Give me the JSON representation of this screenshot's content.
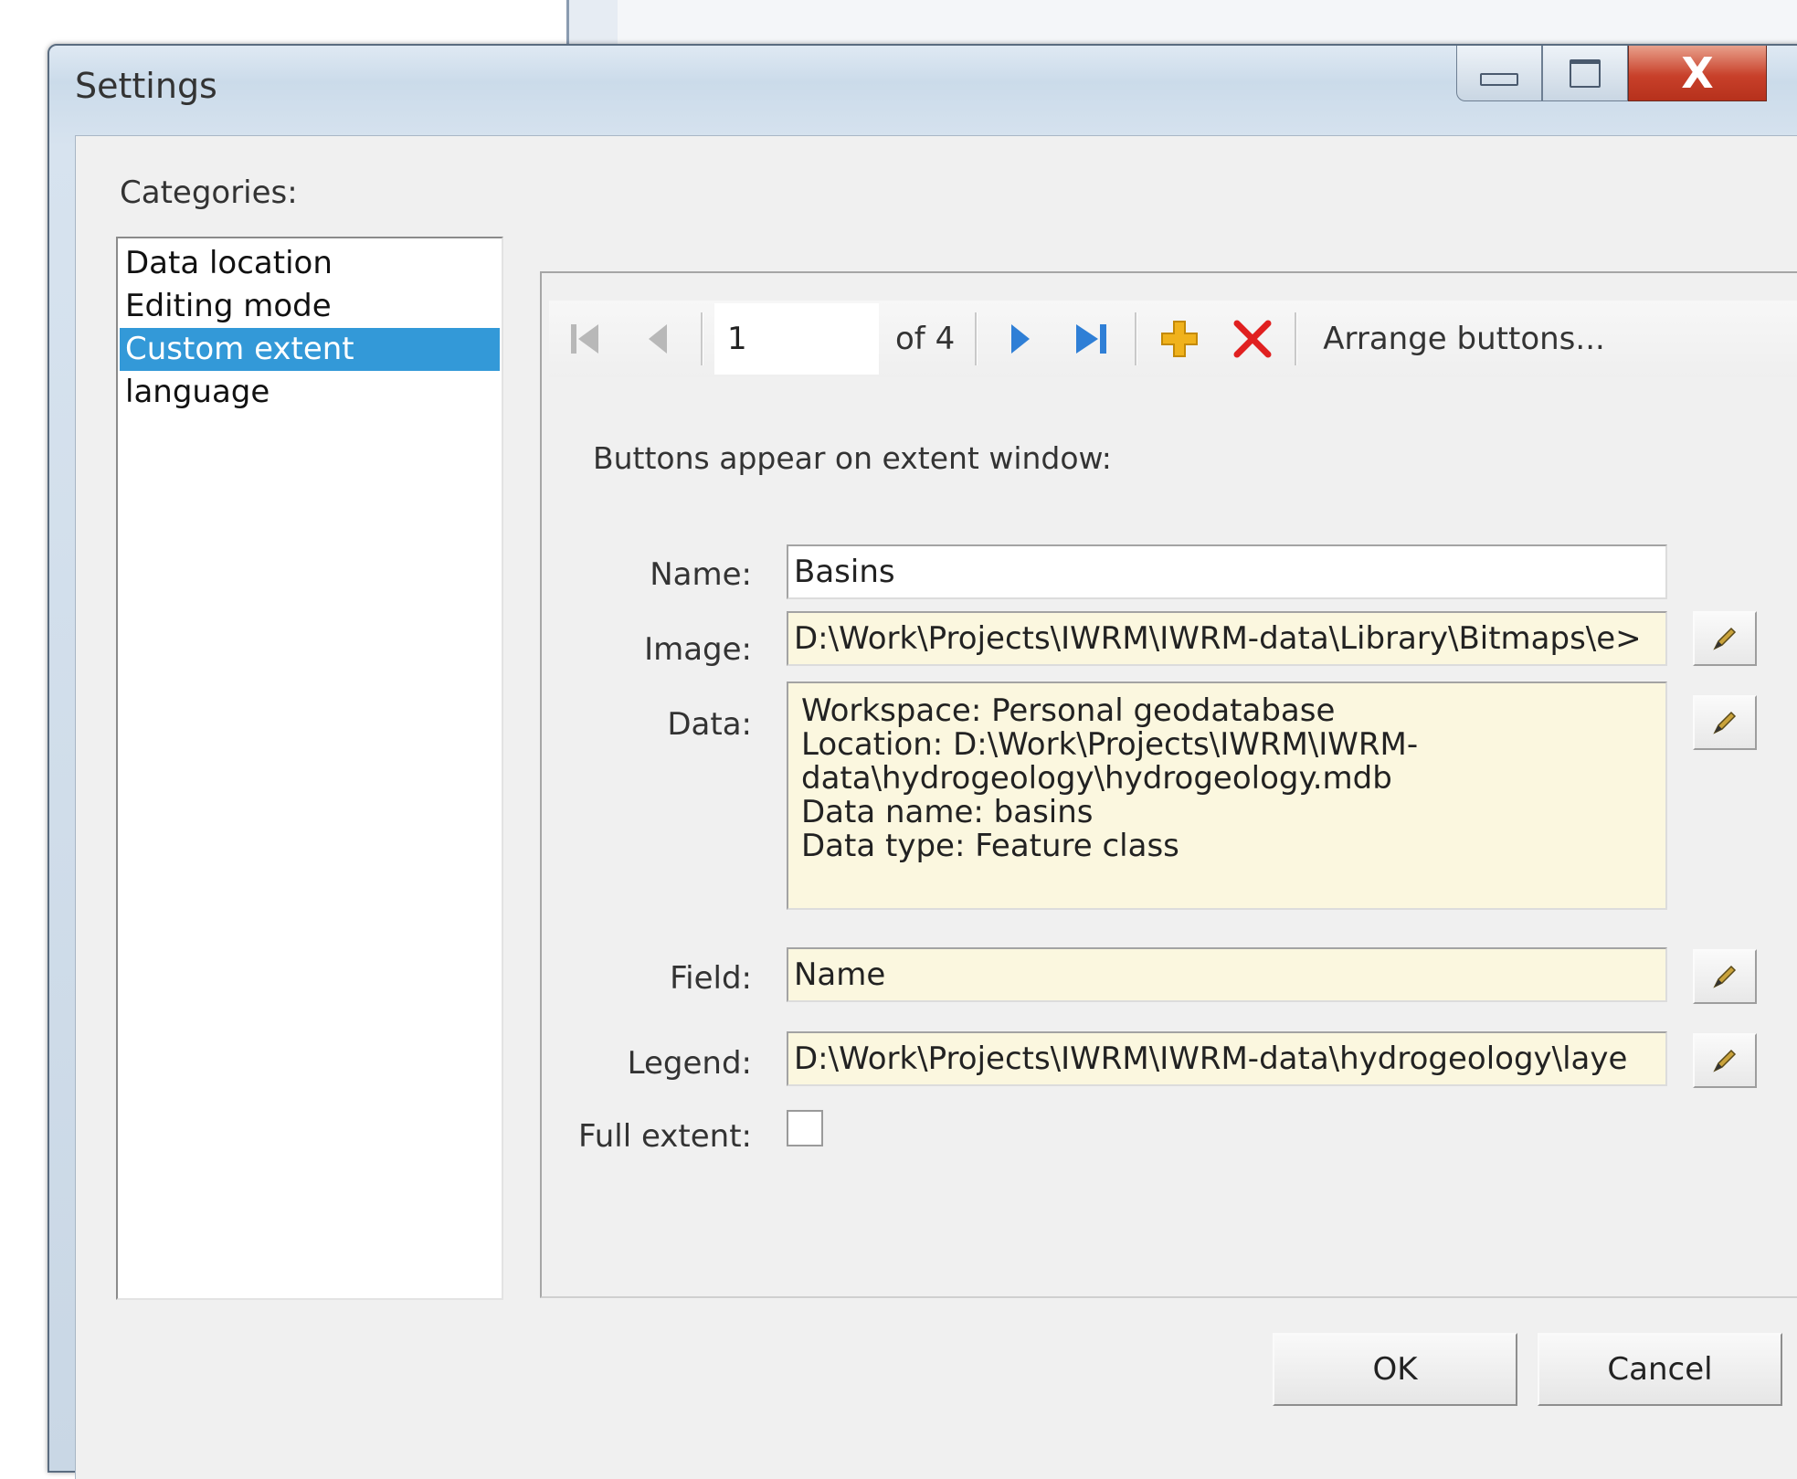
{
  "window": {
    "title": "Settings",
    "close_glyph": "X",
    "icons": {
      "minimize": "minimize-icon",
      "maximize": "maximize-icon",
      "close": "close-icon"
    }
  },
  "categories": {
    "label": "Categories:",
    "items": [
      {
        "label": "Data location",
        "selected": false
      },
      {
        "label": "Editing mode",
        "selected": false
      },
      {
        "label": "Custom extent",
        "selected": true
      },
      {
        "label": "language",
        "selected": false
      }
    ]
  },
  "navigator": {
    "position": "1",
    "count_label": "of 4",
    "arrange_label": "Arrange buttons...",
    "colors": {
      "nav_disabled": "#b8b8b8",
      "nav_active": "#2f7fd6",
      "add": "#f0b21c",
      "delete": "#e02020"
    }
  },
  "form": {
    "hint": "Buttons appear on extent window:",
    "name_label": "Name:",
    "name_value": "Basins",
    "image_label": "Image:",
    "image_value": "D:\\Work\\Projects\\IWRM\\IWRM-data\\Library\\Bitmaps\\e>",
    "data_label": "Data:",
    "data_lines": [
      "Workspace: Personal geodatabase",
      "Location: D:\\Work\\Projects\\IWRM\\IWRM-",
      "data\\hydrogeology\\hydrogeology.mdb",
      "Data name: basins",
      "Data type: Feature class"
    ],
    "field_label": "Field:",
    "field_value": "Name",
    "legend_label": "Legend:",
    "legend_value": "D:\\Work\\Projects\\IWRM\\IWRM-data\\hydrogeology\\laye",
    "full_extent_label": "Full extent:",
    "full_extent_checked": false,
    "readonly_color": "#fbf7df"
  },
  "buttons": {
    "ok": "OK",
    "cancel": "Cancel"
  }
}
